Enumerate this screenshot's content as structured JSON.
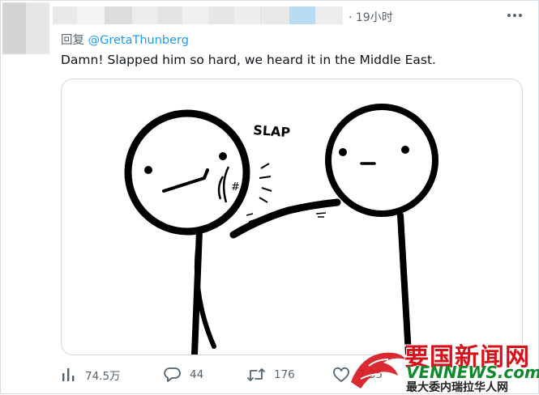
{
  "header": {
    "timestamp": "· 19小时",
    "more_icon": "more-horizontal-icon"
  },
  "tweet": {
    "reply_prefix": "回复",
    "reply_handle": "@GretaThunberg",
    "text": "Damn! Slapped him so hard, we heard it in the Middle East.",
    "media": {
      "sfx_text": "SLAP",
      "mark_text": "#"
    }
  },
  "actions": {
    "views": {
      "icon": "bar-chart-icon",
      "count": "74.5万"
    },
    "replies": {
      "icon": "reply-icon",
      "count": "44"
    },
    "retweets": {
      "icon": "retweet-icon",
      "count": "176"
    },
    "likes": {
      "icon": "heart-icon",
      "count": "7,35"
    }
  },
  "watermark": {
    "title": "要国新闻网",
    "subtitle": "VENNEWS.com",
    "slogan": "最大委内瑞拉华人网"
  },
  "colors": {
    "link": "#1d9bf0",
    "muted": "#536471",
    "text": "#0f1419",
    "watermark_red": "#d6131b",
    "watermark_green": "#0f8b2e"
  }
}
